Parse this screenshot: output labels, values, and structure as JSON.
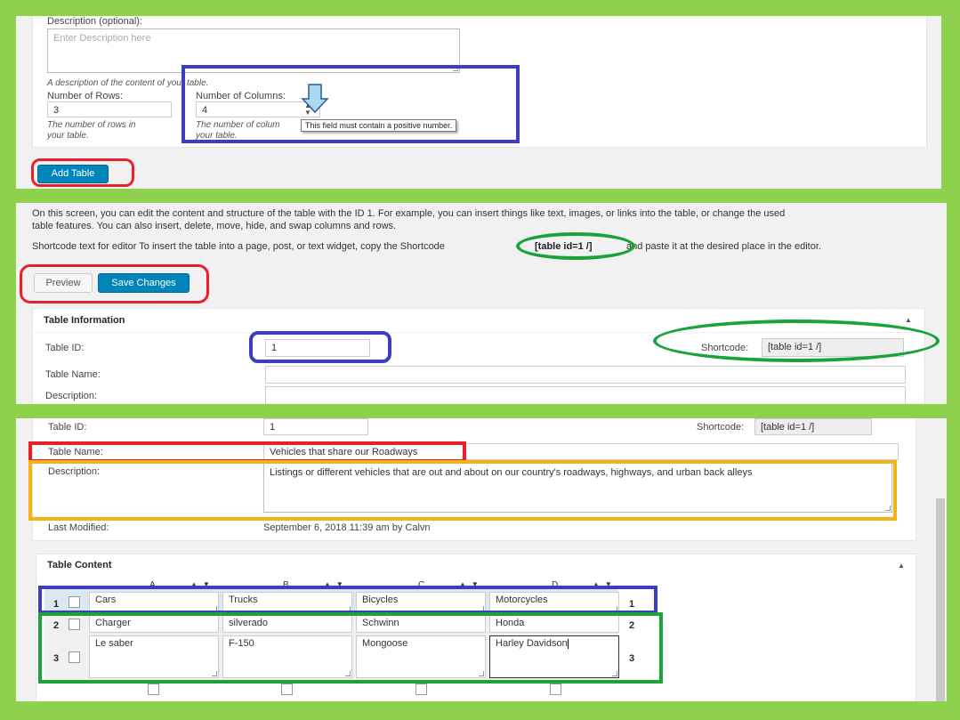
{
  "colors": {
    "frame": "#8dd14f",
    "primary": "#0085ba",
    "red": "#e8202a",
    "blue": "#3b3fbf",
    "green": "#1aa33b",
    "yellow": "#f2b318"
  },
  "panel1": {
    "description_label": "Description (optional):",
    "description_placeholder": "Enter Description here",
    "description_help": "A description of the content of your table.",
    "rows_label": "Number of Rows:",
    "rows_value": "3",
    "rows_help_1": "The number of rows in",
    "rows_help_2": "your table.",
    "cols_label": "Number of Columns:",
    "cols_value": "4",
    "cols_help_1": "The number of colum",
    "cols_help_2": "your table.",
    "tooltip": "This field must contain a positive number.",
    "add_table_label": "Add Table"
  },
  "panel2": {
    "intro_1": "On this screen, you can edit the content and structure of the table with the ID 1. For example, you can insert things like text, images, or links into the table, or change the used",
    "intro_2": "table features. You can also insert, delete, move, hide, and swap columns and rows.",
    "shortcode_prefix": "Shortcode text for editor",
    "shortcode_text_a": "To insert the table into a page, post, or text widget, copy the Shortcode",
    "shortcode_code": "[table id=1 /]",
    "shortcode_text_b": "and paste it at the desired place in the editor.",
    "preview_label": "Preview",
    "save_label": "Save Changes",
    "info_title": "Table Information",
    "table_id_label": "Table ID:",
    "table_id_value": "1",
    "shortcode_label": "Shortcode:",
    "shortcode_value": "[table id=1 /]",
    "table_name_label": "Table Name:",
    "description_label": "Description:"
  },
  "panel3": {
    "table_id_label": "Table ID:",
    "table_id_value": "1",
    "shortcode_label": "Shortcode:",
    "shortcode_value": "[table id=1 /]",
    "table_name_label": "Table Name:",
    "table_name_value": "Vehicles that share our Roadways",
    "description_label": "Description:",
    "description_value": "Listings or different vehicles that are out and about on our country's roadways, highways, and urban back alleys",
    "last_modified_label": "Last Modified:",
    "last_modified_value": "September 6, 2018 11:39 am by Calvn",
    "content_title": "Table Content",
    "columns": [
      "A",
      "B",
      "C",
      "D"
    ],
    "rows": [
      {
        "num": "1",
        "cells": [
          "Cars",
          "Trucks",
          "Bicycles",
          "Motorcycles"
        ]
      },
      {
        "num": "2",
        "cells": [
          "Charger",
          "silverado",
          "Schwinn",
          "Honda"
        ]
      },
      {
        "num": "3",
        "cells": [
          "Le saber",
          "F-150",
          "Mongoose",
          "Harley Davidson"
        ]
      }
    ]
  }
}
